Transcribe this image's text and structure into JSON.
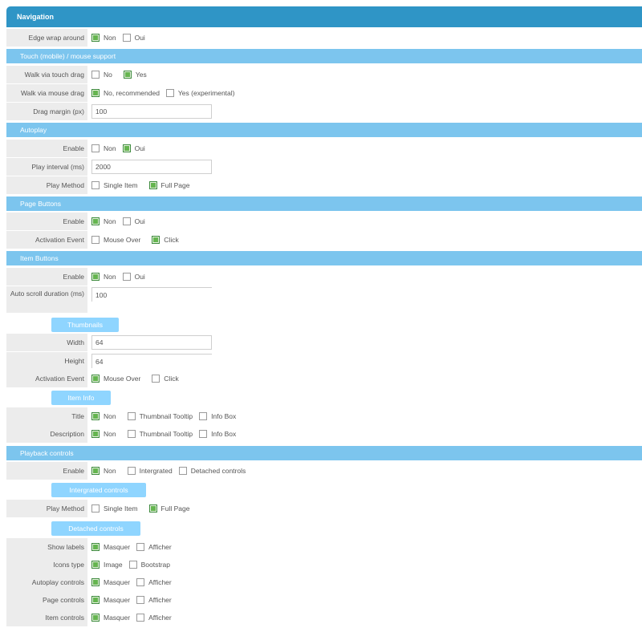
{
  "navigation": {
    "title": "Navigation",
    "edge": {
      "label": "Edge wrap around",
      "opts": [
        "Non",
        "Oui"
      ]
    }
  },
  "touch": {
    "title": "Touch (mobile) / mouse support",
    "walk_touch": {
      "label": "Walk via touch drag",
      "opts": [
        "No",
        "Yes"
      ]
    },
    "walk_mouse": {
      "label": "Walk via mouse drag",
      "opts": [
        "No, recommended",
        "Yes (experimental)"
      ]
    },
    "drag_margin": {
      "label": "Drag margin (px)",
      "value": "100"
    }
  },
  "autoplay": {
    "title": "Autoplay",
    "enable": {
      "label": "Enable",
      "opts": [
        "Non",
        "Oui"
      ]
    },
    "interval": {
      "label": "Play interval (ms)",
      "value": "2000"
    },
    "method": {
      "label": "Play Method",
      "opts": [
        "Single Item",
        "Full Page"
      ]
    }
  },
  "page_buttons": {
    "title": "Page Buttons",
    "enable": {
      "label": "Enable",
      "opts": [
        "Non",
        "Oui"
      ]
    },
    "event": {
      "label": "Activation Event",
      "opts": [
        "Mouse Over",
        "Click"
      ]
    }
  },
  "item_buttons": {
    "title": "Item Buttons",
    "enable": {
      "label": "Enable",
      "opts": [
        "Non",
        "Oui"
      ]
    },
    "scroll": {
      "label": "Auto scroll duration (ms)",
      "value": "100"
    },
    "thumbnails": "Thumbnails",
    "width": {
      "label": "Width",
      "value": "64"
    },
    "height": {
      "label": "Height",
      "value": "64"
    },
    "event": {
      "label": "Activation Event",
      "opts": [
        "Mouse Over",
        "Click"
      ]
    },
    "item_info": "Item Info",
    "title_row": {
      "label": "Title",
      "opts": [
        "Non",
        "Thumbnail Tooltip",
        "Info Box"
      ]
    },
    "description": {
      "label": "Description",
      "opts": [
        "Non",
        "Thumbnail Tooltip",
        "Info Box"
      ]
    }
  },
  "playback": {
    "title": "Playback controls",
    "enable": {
      "label": "Enable",
      "opts": [
        "Non",
        "Intergrated",
        "Detached controls"
      ]
    },
    "integrated": "Intergrated controls",
    "method": {
      "label": "Play Method",
      "opts": [
        "Single Item",
        "Full Page"
      ]
    },
    "detached": "Detached controls",
    "show_labels": {
      "label": "Show labels",
      "opts": [
        "Masquer",
        "Afficher"
      ]
    },
    "icons_type": {
      "label": "Icons type",
      "opts": [
        "Image",
        "Bootstrap"
      ]
    },
    "autoplay_controls": {
      "label": "Autoplay controls",
      "opts": [
        "Masquer",
        "Afficher"
      ]
    },
    "page_controls": {
      "label": "Page controls",
      "opts": [
        "Masquer",
        "Afficher"
      ]
    },
    "item_controls": {
      "label": "Item controls",
      "opts": [
        "Masquer",
        "Afficher"
      ]
    }
  }
}
